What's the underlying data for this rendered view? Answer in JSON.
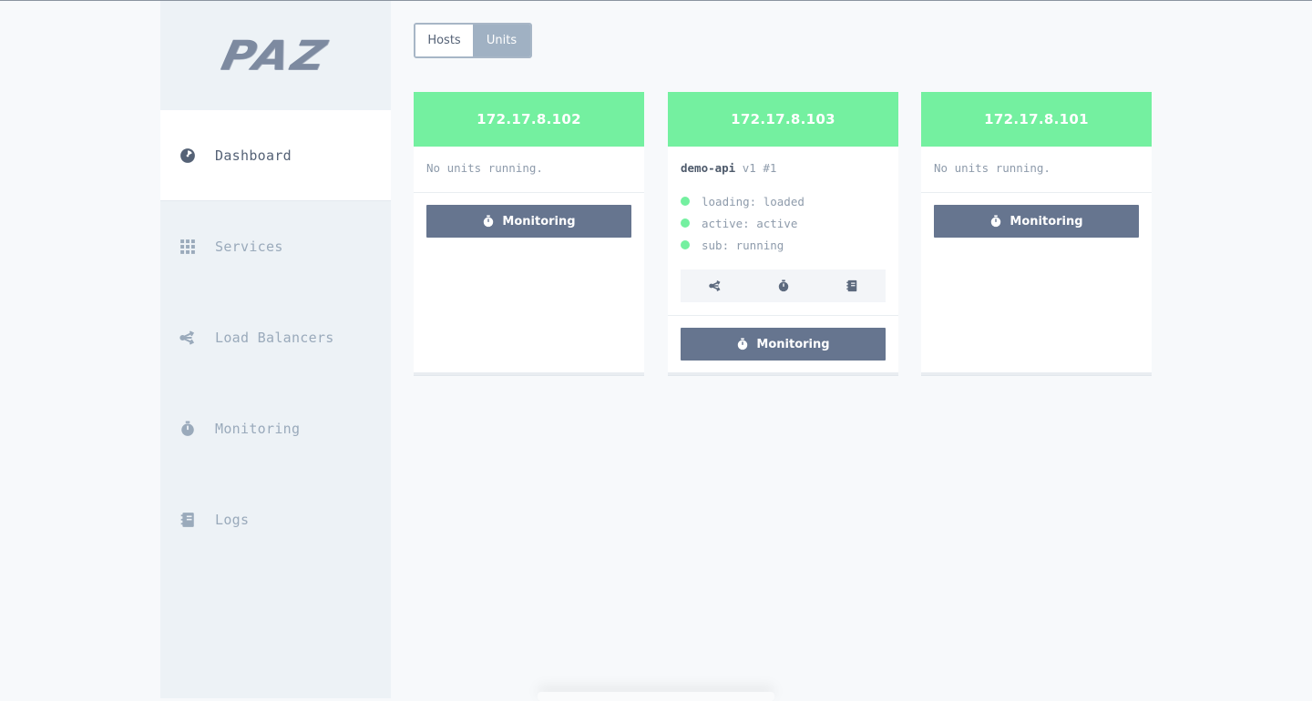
{
  "app": {
    "logo_text": "PAZ"
  },
  "sidebar": {
    "items": [
      {
        "label": "Dashboard",
        "icon": "dashboard-gauge-icon",
        "active": true
      },
      {
        "label": "Services",
        "icon": "grid-icon",
        "active": false
      },
      {
        "label": "Load Balancers",
        "icon": "share-icon",
        "active": false
      },
      {
        "label": "Monitoring",
        "icon": "stopwatch-icon",
        "active": false
      },
      {
        "label": "Logs",
        "icon": "notebook-icon",
        "active": false
      }
    ]
  },
  "view_toggle": {
    "hosts_label": "Hosts",
    "units_label": "Units",
    "selected": "Units"
  },
  "hosts": [
    {
      "ip": "172.17.8.102",
      "empty_text": "No units running.",
      "monitor_label": "Monitoring"
    },
    {
      "ip": "172.17.8.103",
      "unit": {
        "name": "demo-api",
        "version": "v1 #1",
        "statuses": [
          "loading: loaded",
          "active: active",
          "sub: running"
        ]
      },
      "monitor_label": "Monitoring"
    },
    {
      "ip": "172.17.8.101",
      "empty_text": "No units running.",
      "monitor_label": "Monitoring"
    }
  ],
  "colors": {
    "accent_green": "#74f0a0",
    "button_slate": "#66758f",
    "sidebar_bg": "#edf2f6",
    "toggle_selected": "#a0b1c3"
  }
}
